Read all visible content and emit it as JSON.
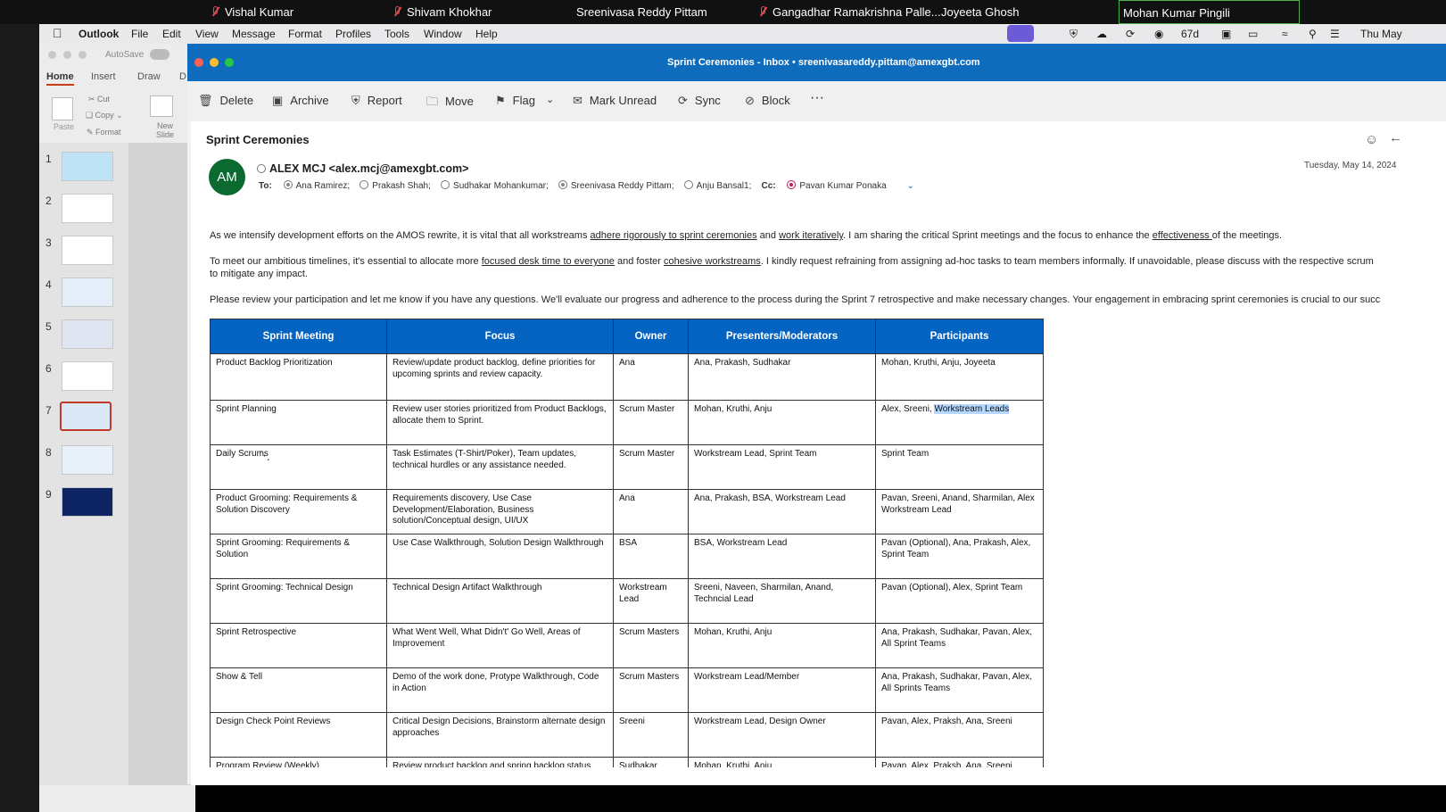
{
  "zoom": {
    "participants": [
      "Vishal Kumar",
      "Shivam Khokhar",
      "Sreenivasa Reddy Pittam",
      "Gangadhar Ramakrishna Palle...",
      "Joyeeta Ghosh",
      "Mohan Kumar Pingili"
    ]
  },
  "menubar": {
    "app": "Outlook",
    "items": [
      "File",
      "Edit",
      "View",
      "Message",
      "Format",
      "Profiles",
      "Tools",
      "Window",
      "Help"
    ],
    "battery_label": "67d",
    "clock": "Thu May"
  },
  "ppt": {
    "autosave": "AutoSave",
    "tabs": [
      "Home",
      "Insert",
      "Draw",
      "D"
    ],
    "paste": "Paste",
    "cut": "Cut",
    "copy": "Copy",
    "format": "Format",
    "new": "New",
    "slide": "Slide",
    "slides": [
      "1",
      "2",
      "3",
      "4",
      "5",
      "6",
      "7",
      "8",
      "9"
    ]
  },
  "outlook": {
    "window_title": "Sprint Ceremonies - Inbox • sreenivasareddy.pittam@amexgbt.com",
    "toolbar": {
      "delete": "Delete",
      "archive": "Archive",
      "report": "Report",
      "move": "Move",
      "flag": "Flag",
      "mark_unread": "Mark Unread",
      "sync": "Sync",
      "block": "Block",
      "more": "···"
    },
    "subject": "Sprint Ceremonies",
    "avatar": "AM",
    "from": "ALEX MCJ <alex.mcj@amexgbt.com>",
    "to_label": "To:",
    "to": [
      "Ana Ramirez;",
      "Prakash Shah;",
      "Sudhakar Mohankumar;",
      "Sreenivasa Reddy Pittam;",
      "Anju Bansal1;"
    ],
    "cc_label": "Cc:",
    "cc": "Pavan Kumar Ponaka",
    "date": "Tuesday, May 14, 2024",
    "body": {
      "p1a": "As we intensify development efforts on the AMOS rewrite, it is vital that all workstreams ",
      "p1b": "adhere rigorously to sprint ceremonies",
      "p1c": " and ",
      "p1d": "work iteratively",
      "p1e": ". I am sharing the critical Sprint meetings and the focus to enhance the ",
      "p1f": "effectiveness ",
      "p1g": "of the meetings.",
      "p2a": "To meet our ambitious timelines, it's essential to allocate more ",
      "p2b": "focused desk time to everyone",
      "p2c": " and foster ",
      "p2d": "cohesive workstreams",
      "p2e": ". I kindly request refraining from assigning ad-hoc tasks to team members informally. If unavoidable, please discuss with the respective scrum",
      "p2f": "to mitigate any impact.",
      "p3": "Please review your participation and let me know if you have any questions. We'll evaluate our progress and adherence to the process during the Sprint 7 retrospective and make necessary changes. Your engagement in embracing sprint ceremonies is crucial to our succ"
    },
    "table": {
      "headers": [
        "Sprint Meeting",
        "Focus",
        "Owner",
        "Presenters/Moderators",
        "Participants"
      ],
      "rows": [
        [
          "Product Backlog Prioritization",
          "Review/update product backlog, define priorities for upcoming sprints and review capacity.",
          "Ana",
          "Ana, Prakash, Sudhakar",
          "Mohan, Kruthi, Anju, Joyeeta"
        ],
        [
          "Sprint Planning",
          "Review user stories prioritized from Product Backlogs, allocate them to Sprint.",
          "Scrum Master",
          "Mohan, Kruthi, Anju",
          "Alex, Sreeni, "
        ],
        [
          "Daily Scrums",
          "Task Estimates (T-Shirt/Poker), Team updates, technical hurdles or any assistance needed.",
          "Scrum Master",
          "Workstream Lead, Sprint Team",
          "Sprint Team"
        ],
        [
          "Product Grooming: Requirements & Solution Discovery",
          "Requirements discovery, Use Case Development/Elaboration, Business solution/Conceptual design, UI/UX",
          "Ana",
          "Ana, Prakash, BSA, Workstream Lead",
          "Pavan, Sreeni, Anand, Sharmilan, Alex Workstream Lead"
        ],
        [
          "Sprint Grooming: Requirements & Solution",
          "Use Case Walkthrough, Solution Design Walkthrough",
          "BSA",
          "BSA, Workstream Lead",
          "Pavan (Optional), Ana, Prakash, Alex, Sprint Team"
        ],
        [
          "Sprint Grooming: Technical Design",
          "Technical Design Artifact Walkthrough",
          "Workstream Lead",
          "Sreeni, Naveen, Sharmilan, Anand, Techncial Lead",
          "Pavan (Optional),  Alex, Sprint Team"
        ],
        [
          "Sprint Retrospective",
          "What Went Well, What Didn't' Go Well, Areas of Improvement",
          "Scrum Masters",
          "Mohan, Kruthi, Anju",
          "Ana, Prakash, Sudhakar, Pavan, Alex, All Sprint Teams"
        ],
        [
          "Show & Tell",
          "Demo of the work done, Protype Walkthrough, Code in Action",
          "Scrum Masters",
          "Workstream Lead/Member",
          "Ana, Prakash, Sudhakar, Pavan, Alex, All Sprints Teams"
        ],
        [
          "Design Check Point Reviews",
          "Critical Design Decisions, Brainstorm alternate design approaches",
          "Sreeni",
          "Workstream Lead, Design Owner",
          "Pavan, Alex, Praksh, Ana, Sreeni"
        ],
        [
          "Program Review (Weekly)",
          "Review product backlog and spring backlog status.",
          "Sudhakar",
          "Mohan, Kruthi, Anju",
          "Pavan, Alex, Praksh, Ana, Sreeni"
        ]
      ],
      "highlight": "Workstream Leads"
    }
  }
}
